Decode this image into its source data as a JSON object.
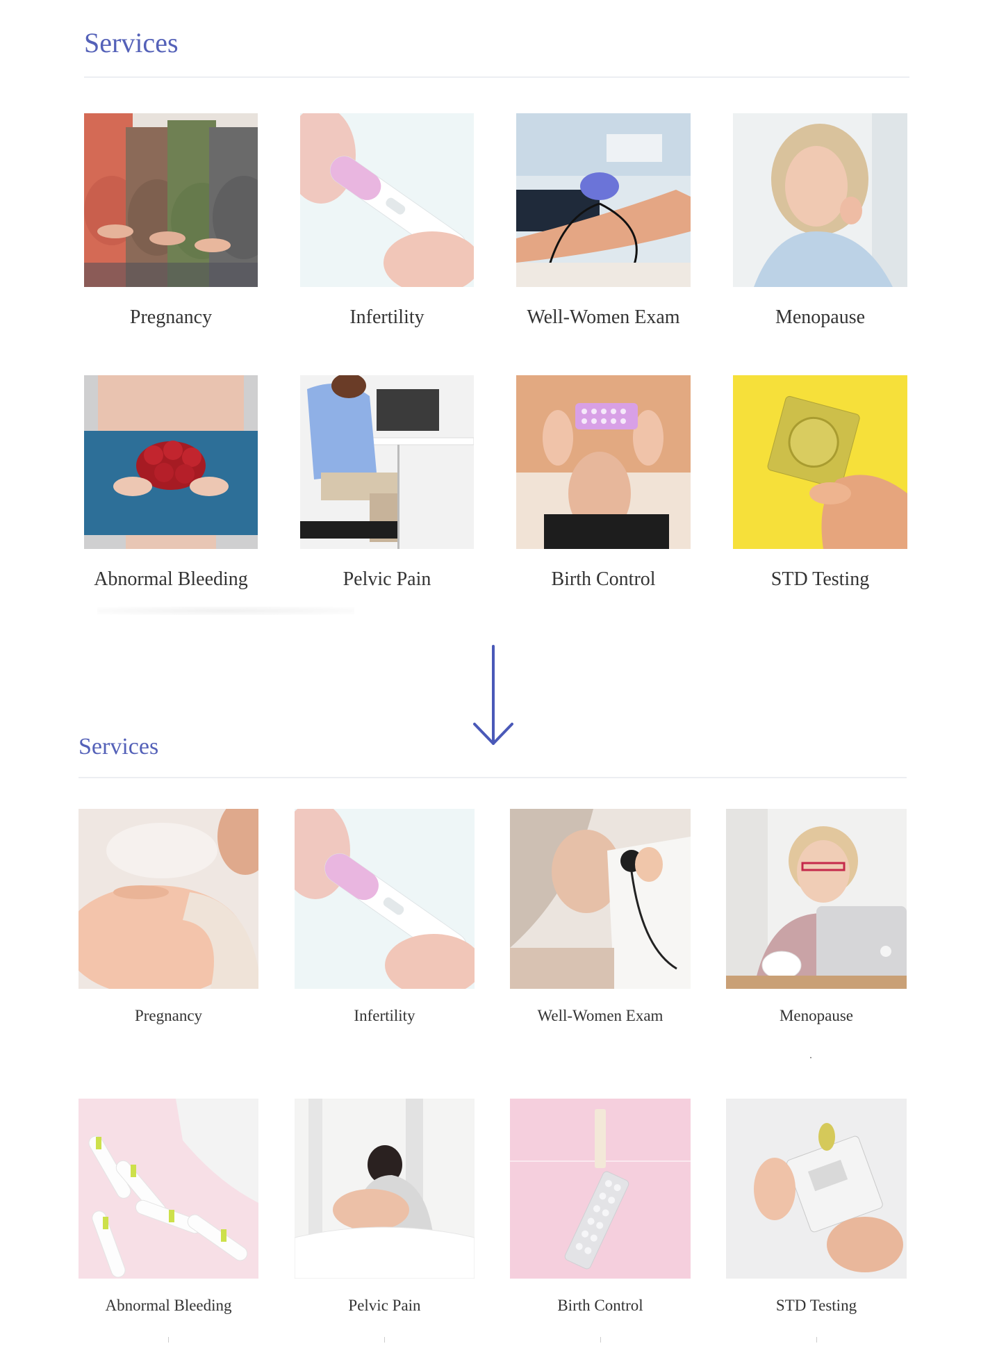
{
  "before": {
    "title": "Services",
    "services": [
      {
        "label": "Pregnancy",
        "icon": "pregnant-women-photo"
      },
      {
        "label": "Infertility",
        "icon": "pregnancy-test-photo"
      },
      {
        "label": "Well-Women Exam",
        "icon": "blood-pressure-photo"
      },
      {
        "label": "Menopause",
        "icon": "mature-woman-photo"
      },
      {
        "label": "Abnormal Bleeding",
        "icon": "roses-photo"
      },
      {
        "label": "Pelvic Pain",
        "icon": "back-pain-photo"
      },
      {
        "label": "Birth Control",
        "icon": "pill-pack-photo"
      },
      {
        "label": "STD Testing",
        "icon": "condom-photo"
      }
    ]
  },
  "after": {
    "title": "Services",
    "services": [
      {
        "label": "Pregnancy",
        "icon": "pregnant-belly-photo"
      },
      {
        "label": "Infertility",
        "icon": "pregnancy-test-photo"
      },
      {
        "label": "Well-Women Exam",
        "icon": "stethoscope-photo"
      },
      {
        "label": "Menopause",
        "icon": "woman-laptop-photo"
      },
      {
        "label": "Abnormal Bleeding",
        "icon": "tampons-photo"
      },
      {
        "label": "Pelvic Pain",
        "icon": "woman-in-bed-photo"
      },
      {
        "label": "Birth Control",
        "icon": "pill-clothespin-photo"
      },
      {
        "label": "STD Testing",
        "icon": "test-packet-photo"
      }
    ]
  },
  "colors": {
    "accent": "#5461b8",
    "arrow": "#4a59b8"
  },
  "arrow_icon": "down-arrow-icon"
}
